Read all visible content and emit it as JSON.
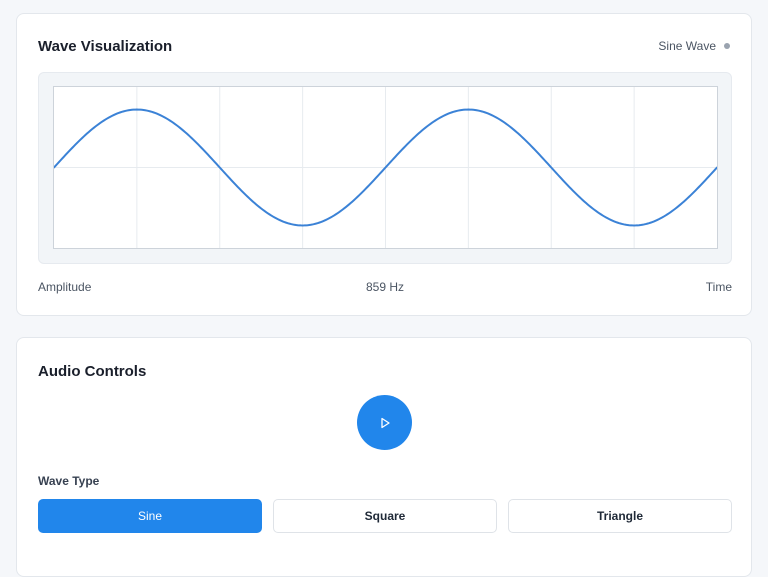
{
  "visualization": {
    "title": "Wave Visualization",
    "status_label": "Sine Wave",
    "x_axis_left": "Amplitude",
    "frequency_label": "859 Hz",
    "x_axis_right": "Time",
    "wave": {
      "type": "sine",
      "cycles": 2,
      "amplitude": 0.72,
      "phase_degrees": 0,
      "color": "#3b82d6"
    },
    "grid": true
  },
  "controls": {
    "title": "Audio Controls",
    "play_icon": "play-icon",
    "wave_type_label": "Wave Type",
    "wave_types": [
      "Sine",
      "Square",
      "Triangle"
    ],
    "selected_wave_type": "Sine",
    "accent_color": "#2186eb"
  }
}
